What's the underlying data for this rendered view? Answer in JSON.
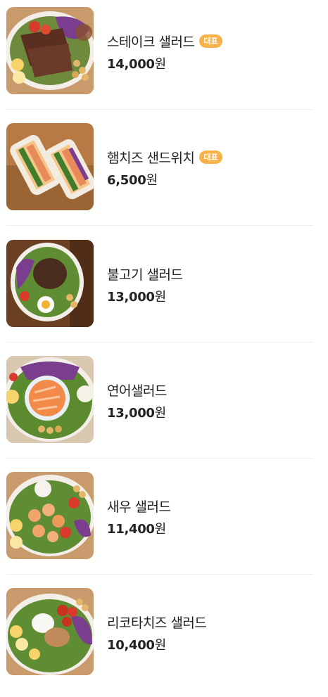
{
  "menu": {
    "items": [
      {
        "name": "스테이크 샐러드",
        "badge": "대표",
        "price": "14,000",
        "unit": "원",
        "photo": "steak-salad-photo"
      },
      {
        "name": "햄치즈 샌드위치",
        "badge": "대표",
        "price": "6,500",
        "unit": "원",
        "photo": "ham-cheese-sandwich-photo"
      },
      {
        "name": "불고기 샐러드",
        "badge": "",
        "price": "13,000",
        "unit": "원",
        "photo": "bulgogi-salad-photo"
      },
      {
        "name": "연어샐러드",
        "badge": "",
        "price": "13,000",
        "unit": "원",
        "photo": "salmon-salad-photo"
      },
      {
        "name": "새우 샐러드",
        "badge": "",
        "price": "11,400",
        "unit": "원",
        "photo": "shrimp-salad-photo"
      },
      {
        "name": "리코타치즈 샐러드",
        "badge": "",
        "price": "10,400",
        "unit": "원",
        "photo": "ricotta-cheese-salad-photo"
      }
    ]
  },
  "colors": {
    "badge": "#f7b24a",
    "divider": "#eeeeee",
    "text": "#222222"
  }
}
